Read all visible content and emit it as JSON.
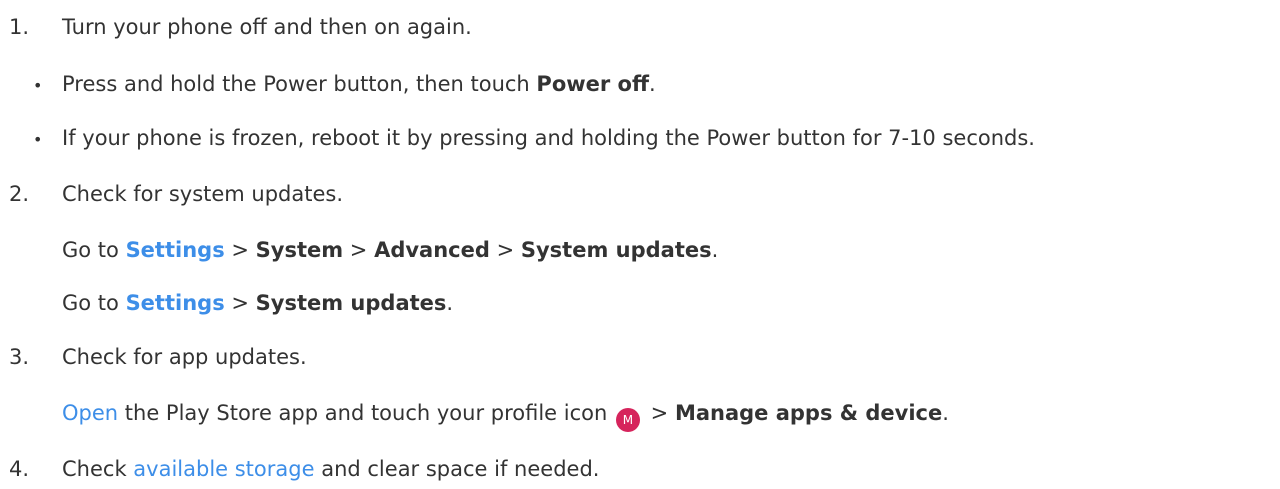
{
  "steps": [
    {
      "number": "1.",
      "title": "Turn your phone off and then on again.",
      "bullets": [
        {
          "text_before": "Press and hold the Power button, then touch ",
          "bold": "Power off",
          "text_after": "."
        },
        {
          "text": "If your phone is frozen, reboot it by pressing and holding the Power button for 7-10 seconds."
        }
      ]
    },
    {
      "number": "2.",
      "title": "Check for system updates.",
      "path_a": {
        "go_to": "Go to ",
        "settings_link": "Settings",
        "sep": " > ",
        "system": "System",
        "advanced": "Advanced",
        "system_updates": "System updates",
        "end": "."
      },
      "path_b": {
        "go_to": "Go to ",
        "settings_link": "Settings",
        "sep": " > ",
        "system_updates": "System updates",
        "end": "."
      }
    },
    {
      "number": "3.",
      "title": "Check for app updates.",
      "detail": {
        "open_link": "Open",
        "text_mid": " the Play Store app and touch your profile icon ",
        "profile_initial": "M",
        "sep": " > ",
        "manage": "Manage apps & device",
        "end": "."
      }
    },
    {
      "number": "4.",
      "title_before": "Check ",
      "storage_link": "available storage",
      "title_after": " and clear space if needed."
    }
  ],
  "colors": {
    "link": "#3d8ee8",
    "text": "#333333",
    "profile_badge": "#d6245c"
  },
  "icons": {
    "bullet": "•",
    "profile": "profile-avatar-icon"
  }
}
